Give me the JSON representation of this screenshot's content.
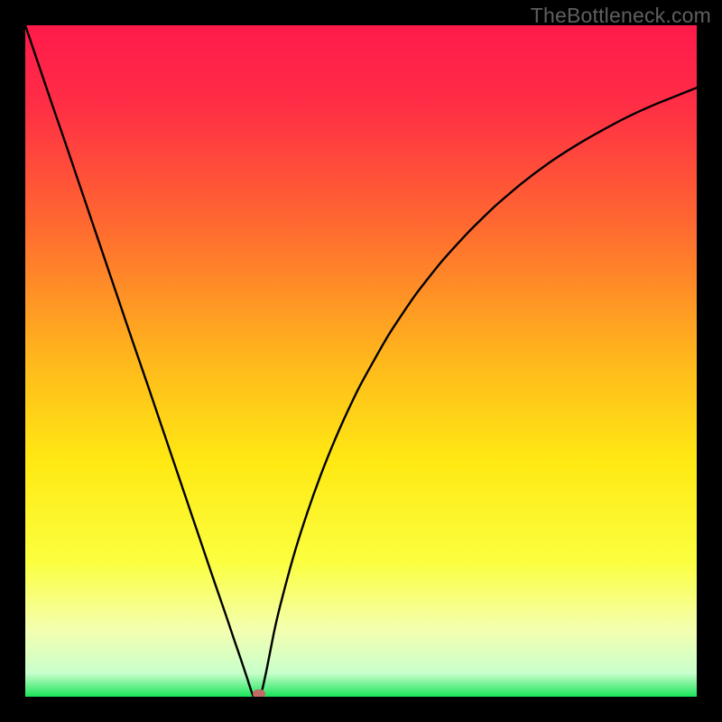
{
  "watermark": "TheBottleneck.com",
  "colors": {
    "frame_bg": "#000000",
    "gradient_stops": [
      {
        "offset": 0.0,
        "color": "#ff1a4b"
      },
      {
        "offset": 0.12,
        "color": "#ff2e45"
      },
      {
        "offset": 0.3,
        "color": "#ff6a30"
      },
      {
        "offset": 0.5,
        "color": "#ffb81c"
      },
      {
        "offset": 0.65,
        "color": "#ffe913"
      },
      {
        "offset": 0.8,
        "color": "#fbff40"
      },
      {
        "offset": 0.9,
        "color": "#f4ffb0"
      },
      {
        "offset": 0.965,
        "color": "#c8ffcb"
      },
      {
        "offset": 1.0,
        "color": "#18e558"
      }
    ],
    "curve": "#000000",
    "marker": "#c26a67"
  },
  "chart_data": {
    "type": "line",
    "title": "",
    "xlabel": "",
    "ylabel": "",
    "xlim": [
      0,
      100
    ],
    "ylim": [
      0,
      100
    ],
    "grid": false,
    "legend": false,
    "x": [
      0,
      2,
      4,
      6,
      8,
      10,
      12,
      14,
      16,
      18,
      20,
      22,
      24,
      26,
      28,
      30,
      31,
      32,
      33,
      34,
      35,
      36,
      37,
      38,
      40,
      42,
      44,
      46,
      48,
      50,
      54,
      58,
      62,
      66,
      70,
      74,
      78,
      82,
      86,
      90,
      94,
      98,
      100
    ],
    "values": [
      100,
      94.1,
      88.2,
      82.4,
      76.5,
      70.6,
      64.7,
      58.8,
      52.9,
      47.1,
      41.2,
      35.3,
      29.4,
      23.5,
      17.6,
      11.8,
      8.8,
      5.9,
      2.9,
      0,
      0,
      4.3,
      9.4,
      13.7,
      21.1,
      27.4,
      33.0,
      38.0,
      42.5,
      46.6,
      53.7,
      59.7,
      64.8,
      69.2,
      73.1,
      76.5,
      79.5,
      82.1,
      84.4,
      86.5,
      88.3,
      89.9,
      90.7
    ],
    "marker": {
      "x": 34.8,
      "y": 0.4
    }
  }
}
